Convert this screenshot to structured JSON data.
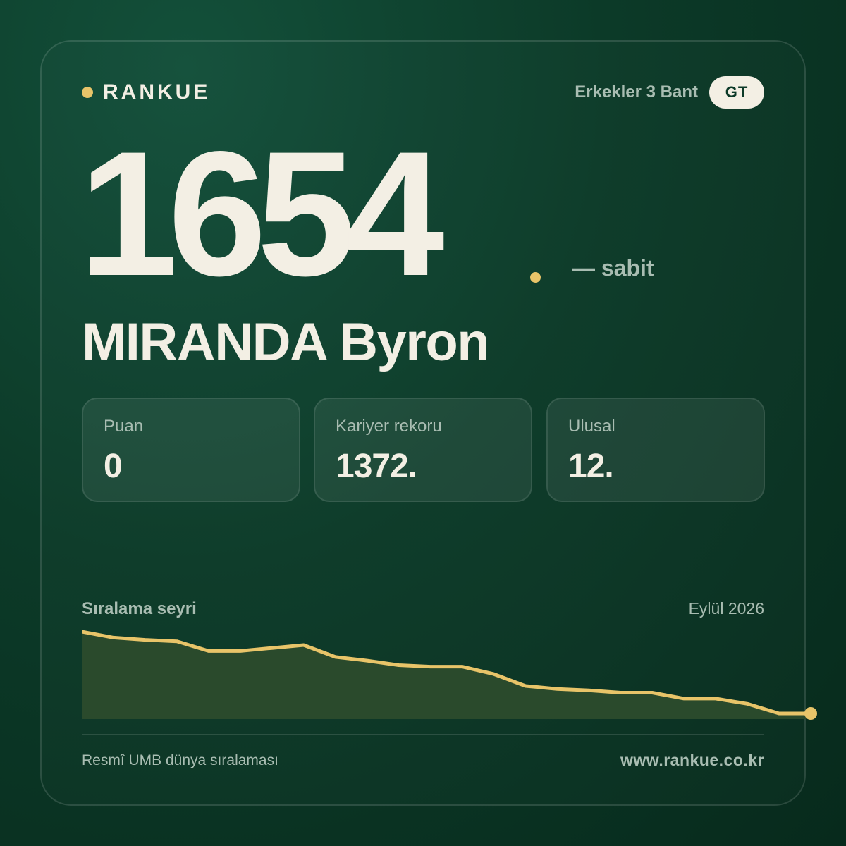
{
  "brand": {
    "name": "RANKUE"
  },
  "category": {
    "label": "Erkekler 3 Bant",
    "country_code": "GT"
  },
  "player": {
    "rank": "1654",
    "change": "— sabit",
    "name": "MIRANDA Byron"
  },
  "stats": [
    {
      "label": "Puan",
      "value": "0"
    },
    {
      "label": "Kariyer rekoru",
      "value": "1372."
    },
    {
      "label": "Ulusal",
      "value": "12."
    }
  ],
  "trend": {
    "title": "Sıralama seyri",
    "date": "Eylül 2026"
  },
  "footer": {
    "source": "Resmî UMB dünya sıralaması",
    "website": "www.rankue.co.kr"
  },
  "colors": {
    "accent": "#e8c469",
    "background": "#0c3a28",
    "text": "#f3efe4",
    "muted": "#a9bdb2"
  },
  "chart_data": {
    "type": "area",
    "values": [
      0,
      8,
      11,
      13,
      26,
      26,
      22,
      18,
      34,
      39,
      45,
      47,
      47,
      57,
      73,
      77,
      79,
      82,
      82,
      90,
      90,
      97,
      110,
      110
    ]
  }
}
